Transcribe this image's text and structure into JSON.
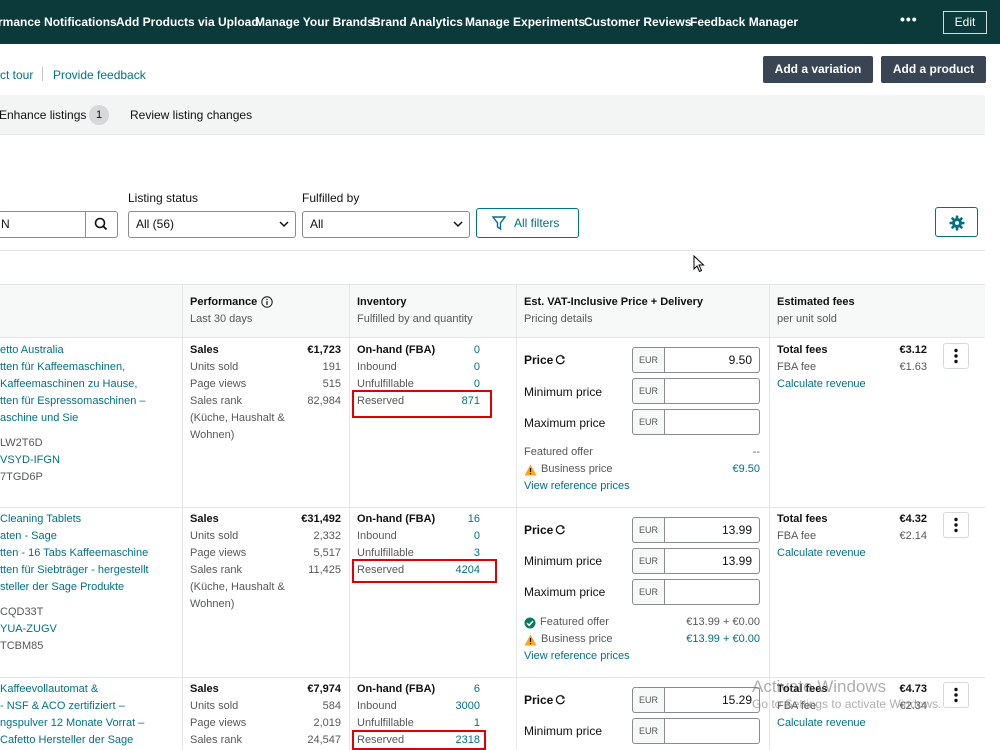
{
  "nav": {
    "items": [
      "rmance Notifications",
      "Add Products via Upload",
      "Manage Your Brands",
      "Brand Analytics",
      "Manage Experiments",
      "Customer Reviews",
      "Feedback Manager"
    ],
    "more": "•••",
    "edit": "Edit"
  },
  "subheader": {
    "tour": "ct tour",
    "feedback": "Provide feedback",
    "add_variation": "Add a variation",
    "add_product": "Add a product"
  },
  "tabs": {
    "enhance": "Enhance listings",
    "enhance_count": "1",
    "review": "Review listing changes"
  },
  "filters": {
    "search_value": "N",
    "listing_status_label": "Listing status",
    "listing_status_value": "All (56)",
    "fulfilled_by_label": "Fulfilled by",
    "fulfilled_by_value": "All",
    "all_filters": "All filters"
  },
  "columns": {
    "performance": "Performance",
    "performance_sub": "Last 30 days",
    "inventory": "Inventory",
    "inventory_sub": "Fulfilled by and quantity",
    "price": "Est. VAT-Inclusive Price + Delivery",
    "price_sub": "Pricing details",
    "fees": "Estimated fees",
    "fees_sub": "per unit sold"
  },
  "rows": [
    {
      "title_lines": [
        "etto Australia",
        "tten für Kaffeemaschinen,",
        "Kaffeemaschinen zu Hause,",
        "tten für Espressomaschinen –",
        "aschine und Sie"
      ],
      "ids": [
        "LW2T6D",
        "VSYD-IFGN",
        "7TGD6P"
      ],
      "perf": {
        "sales_label": "Sales",
        "sales": "€1,723",
        "units_label": "Units sold",
        "units": "191",
        "views_label": "Page views",
        "views": "515",
        "rank_label": "Sales rank",
        "rank": "82,984",
        "category": [
          "(Küche, Haushalt &",
          "Wohnen)"
        ]
      },
      "inv": {
        "onhand_label": "On-hand (FBA)",
        "onhand": "0",
        "inbound_label": "Inbound",
        "inbound": "0",
        "unfulfillable_label": "Unfulfillable",
        "unfulfillable": "0",
        "reserved_label": "Reserved",
        "reserved": "871"
      },
      "price": {
        "price_label": "Price",
        "currency": "EUR",
        "price": "9.50",
        "min_label": "Minimum price",
        "min": "",
        "max_label": "Maximum price",
        "max": "",
        "featured_label": "Featured offer",
        "featured": "--",
        "business_label": "Business price",
        "business": "€9.50",
        "reference": "View reference prices"
      },
      "fees": {
        "total_label": "Total fees",
        "total": "€3.12",
        "fba_label": "FBA fee",
        "fba": "€1.63",
        "calc": "Calculate revenue"
      }
    },
    {
      "title_lines": [
        "Cleaning Tablets",
        "aten - Sage",
        "tten - 16 Tabs Kaffeemaschine",
        "tten für Siebträger - hergestellt",
        "steller der Sage Produkte"
      ],
      "ids": [
        "CQD33T",
        "YUA-ZUGV",
        "TCBM85"
      ],
      "perf": {
        "sales_label": "Sales",
        "sales": "€31,492",
        "units_label": "Units sold",
        "units": "2,332",
        "views_label": "Page views",
        "views": "5,517",
        "rank_label": "Sales rank",
        "rank": "11,425",
        "category": [
          "(Küche, Haushalt &",
          "Wohnen)"
        ]
      },
      "inv": {
        "onhand_label": "On-hand (FBA)",
        "onhand": "16",
        "inbound_label": "Inbound",
        "inbound": "0",
        "unfulfillable_label": "Unfulfillable",
        "unfulfillable": "3",
        "reserved_label": "Reserved",
        "reserved": "4204"
      },
      "price": {
        "price_label": "Price",
        "currency": "EUR",
        "price": "13.99",
        "min_label": "Minimum price",
        "min": "13.99",
        "max_label": "Maximum price",
        "max": "",
        "featured_label": "Featured offer",
        "featured": "€13.99 + €0.00",
        "business_label": "Business price",
        "business": "€13.99 + €0.00",
        "reference": "View reference prices"
      },
      "fees": {
        "total_label": "Total fees",
        "total": "€4.32",
        "fba_label": "FBA fee",
        "fba": "€2.14",
        "calc": "Calculate revenue"
      }
    },
    {
      "title_lines": [
        "Kaffeevollautomat &",
        "- NSF & ACO zertifiziert –",
        "ngspulver 12 Monate Vorrat –",
        "Cafetto Hersteller der Sage"
      ],
      "perf": {
        "sales_label": "Sales",
        "sales": "€7,974",
        "units_label": "Units sold",
        "units": "584",
        "views_label": "Page views",
        "views": "2,019",
        "rank_label": "Sales rank",
        "rank": "24,547"
      },
      "inv": {
        "onhand_label": "On-hand (FBA)",
        "onhand": "6",
        "inbound_label": "Inbound",
        "inbound": "3000",
        "unfulfillable_label": "Unfulfillable",
        "unfulfillable": "1",
        "reserved_label": "Reserved",
        "reserved": "2318"
      },
      "price": {
        "price_label": "Price",
        "currency": "EUR",
        "price": "15.29",
        "min_label": "Minimum price",
        "min": ""
      },
      "fees": {
        "total_label": "Total fees",
        "total": "€4.73",
        "fba_label": "FBA fee",
        "fba": "€2.34",
        "calc": "Calculate revenue"
      }
    }
  ],
  "watermark": {
    "line1": "Activate Windows",
    "line2": "Go to Settings to activate Windows."
  },
  "colors": {
    "nav_bg": "#0c3a3a",
    "link": "#007185",
    "highlight": "#e00000",
    "warning": "#ffa41c",
    "success": "#067d62"
  }
}
